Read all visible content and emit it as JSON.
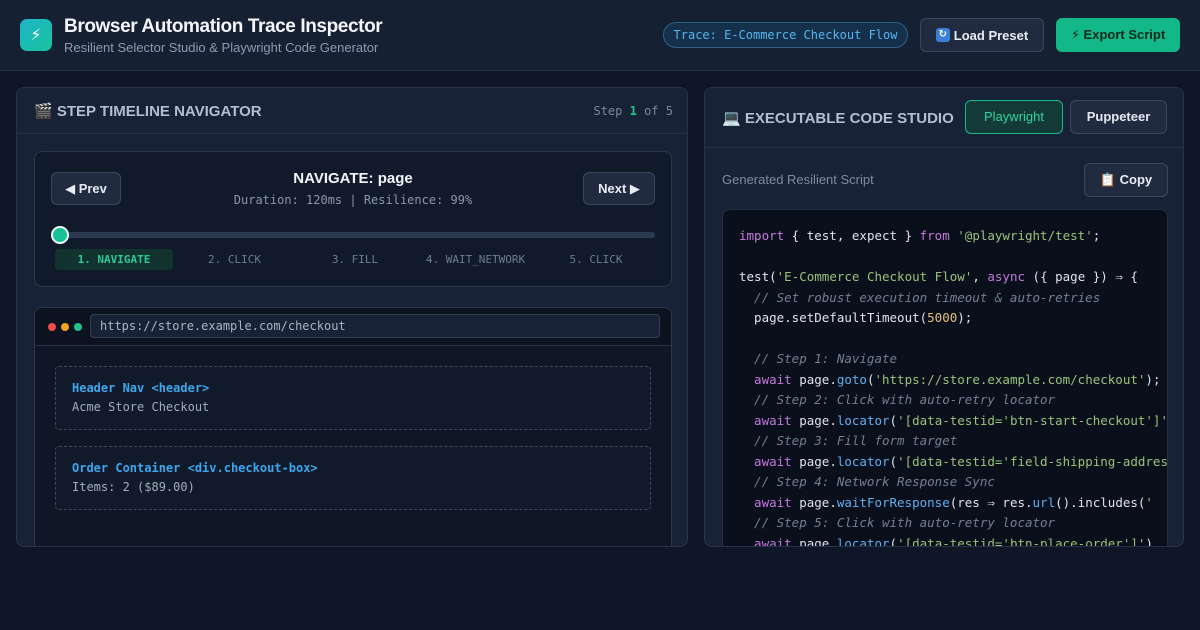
{
  "header": {
    "logo_glyph": "⚡",
    "title": "Browser Automation Trace Inspector",
    "subtitle": "Resilient Selector Studio & Playwright Code Generator",
    "trace_badge": "Trace: E-Commerce Checkout Flow",
    "load_button": "Load Preset",
    "load_icon": "reload-icon",
    "export_button": "⚡ Export Script"
  },
  "timeline": {
    "title": "🎬 STEP TIMELINE NAVIGATOR",
    "step_word": "Step",
    "current_step": "1",
    "of_word": "of",
    "total_steps": "5",
    "prev_button": "◀ Prev",
    "next_button": "Next ▶",
    "step_title": "NAVIGATE: page",
    "step_meta": "Duration: 120ms | Resilience: 99%",
    "progress": 0,
    "steps": [
      "1. NAVIGATE",
      "2. CLICK",
      "3. FILL",
      "4. WAIT_NETWORK",
      "5. CLICK"
    ],
    "active_step_index": 0
  },
  "browser": {
    "url": "https://store.example.com/checkout",
    "elements": [
      {
        "label": "Header Nav <header>",
        "value": "Acme Store Checkout"
      },
      {
        "label": "Order Container <div.checkout-box>",
        "value": "Items: 2 ($89.00)"
      }
    ]
  },
  "code_studio": {
    "title": "💻 EXECUTABLE CODE STUDIO",
    "tabs": {
      "playwright": "Playwright",
      "puppeteer": "Puppeteer"
    },
    "active_tab": "Playwright",
    "script_label": "Generated Resilient Script",
    "copy_button": "📋 Copy",
    "code_lines": [
      [
        [
          "kw",
          "import"
        ],
        [
          "txt",
          " { test, expect } "
        ],
        [
          "kw",
          "from"
        ],
        [
          "txt",
          " "
        ],
        [
          "str",
          "'@playwright/test'"
        ],
        [
          "txt",
          ";"
        ]
      ],
      [],
      [
        [
          "txt",
          "test("
        ],
        [
          "str",
          "'E-Commerce Checkout Flow'"
        ],
        [
          "txt",
          ", "
        ],
        [
          "kw",
          "async"
        ],
        [
          "txt",
          " ({ page }) ⇒ {"
        ]
      ],
      [
        [
          "com",
          "  // Set robust execution timeout & auto-retries"
        ]
      ],
      [
        [
          "txt",
          "  page.setDefaultTimeout("
        ],
        [
          "num",
          "5000"
        ],
        [
          "txt",
          ");"
        ]
      ],
      [],
      [
        [
          "com",
          "  // Step 1: Navigate"
        ]
      ],
      [
        [
          "kw",
          "  await"
        ],
        [
          "txt",
          " page."
        ],
        [
          "fn",
          "goto"
        ],
        [
          "txt",
          "("
        ],
        [
          "str",
          "'https://store.example.com/checkout'"
        ],
        [
          "txt",
          ");"
        ]
      ],
      [
        [
          "com",
          "  // Step 2: Click with auto-retry locator"
        ]
      ],
      [
        [
          "kw",
          "  await"
        ],
        [
          "txt",
          " page."
        ],
        [
          "fn",
          "locator"
        ],
        [
          "txt",
          "("
        ],
        [
          "str",
          "'[data-testid='btn-start-checkout']'"
        ],
        [
          "txt",
          ")"
        ]
      ],
      [
        [
          "com",
          "  // Step 3: Fill form target"
        ]
      ],
      [
        [
          "kw",
          "  await"
        ],
        [
          "txt",
          " page."
        ],
        [
          "fn",
          "locator"
        ],
        [
          "txt",
          "("
        ],
        [
          "str",
          "'[data-testid='field-shipping-address']'"
        ],
        [
          "txt",
          ")"
        ]
      ],
      [
        [
          "com",
          "  // Step 4: Network Response Sync"
        ]
      ],
      [
        [
          "kw",
          "  await"
        ],
        [
          "txt",
          " page."
        ],
        [
          "fn",
          "waitForResponse"
        ],
        [
          "txt",
          "(res ⇒ res."
        ],
        [
          "fn",
          "url"
        ],
        [
          "txt",
          "().includes("
        ],
        [
          "str",
          "'"
        ]
      ],
      [
        [
          "com",
          "  // Step 5: Click with auto-retry locator"
        ]
      ],
      [
        [
          "kw",
          "  await"
        ],
        [
          "txt",
          " page."
        ],
        [
          "fn",
          "locator"
        ],
        [
          "txt",
          "("
        ],
        [
          "str",
          "'[data-testid='btn-place-order']'"
        ],
        [
          "txt",
          ")"
        ]
      ]
    ]
  },
  "colors": {
    "background": "#0f1627",
    "panel": "#172236",
    "accent_green": "#12b886",
    "accent_blue": "#58b6f0"
  }
}
